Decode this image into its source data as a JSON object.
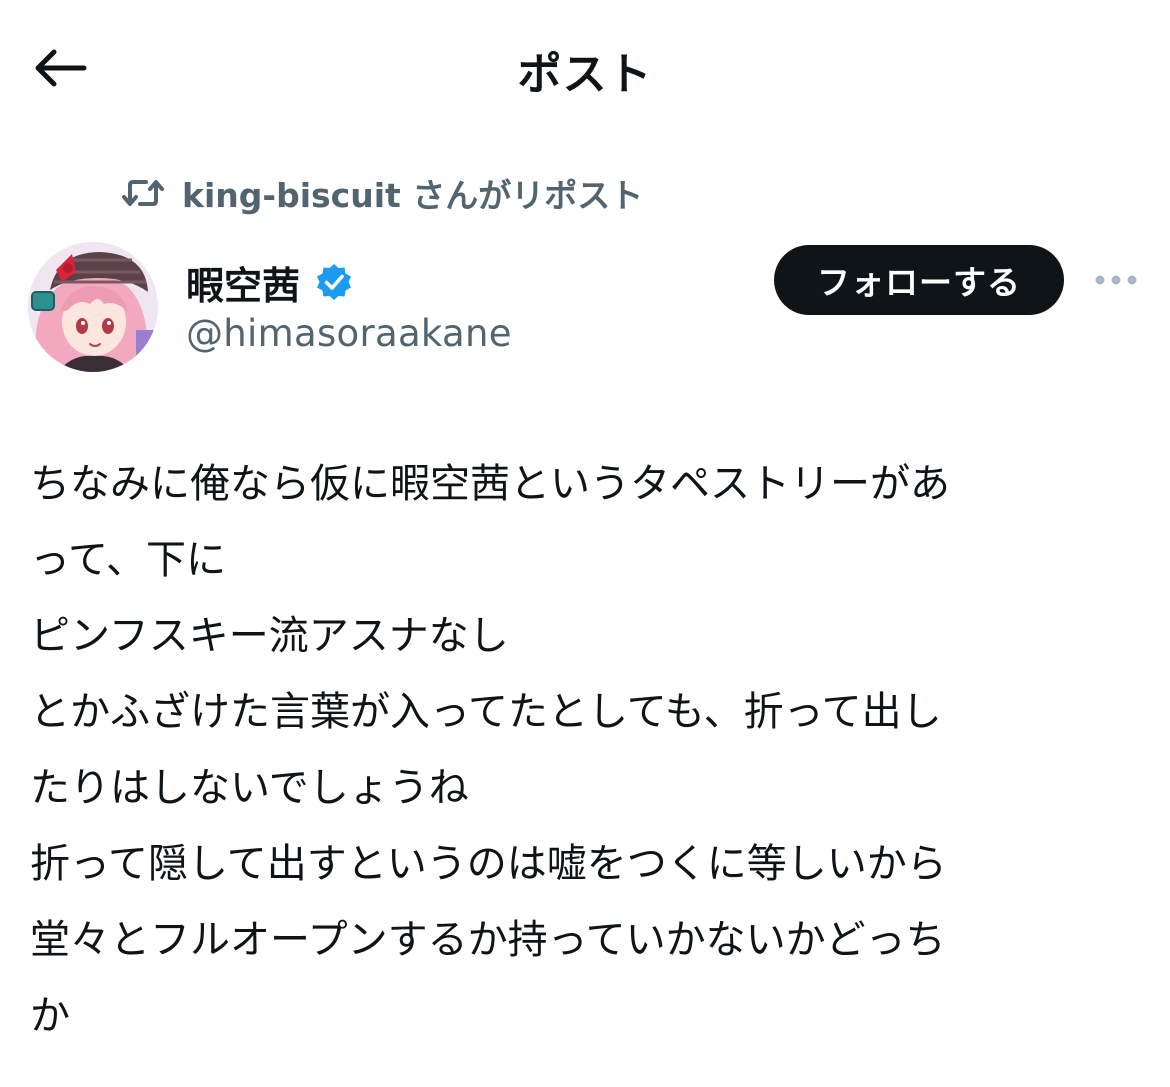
{
  "header": {
    "title": "ポスト",
    "back_icon": "arrow-left-icon"
  },
  "repost": {
    "text": "king-biscuit さんがリポスト",
    "icon": "repost-icon",
    "color": "#536471"
  },
  "author": {
    "name": "暇空茜",
    "handle": "@himasoraakane",
    "verified": true,
    "verified_color": "#1d9bf0"
  },
  "actions": {
    "follow_label": "フォローする",
    "more_icon": "more-horizontal-icon"
  },
  "post": {
    "lines": [
      "ちなみに俺なら仮に暇空茜というタペストリーがあ",
      "って、下に",
      "ピンフスキー流アスナなし",
      "とかふざけた言葉が入ってたとしても、折って出し",
      "たりはしないでしょうね",
      "折って隠して出すというのは嘘をつくに等しいから",
      "堂々とフルオープンするか持っていかないかどっち",
      "か"
    ]
  },
  "colors": {
    "text_primary": "#0f1419",
    "text_secondary": "#536471",
    "follow_bg": "#0f1419",
    "follow_text": "#ffffff",
    "background": "#ffffff"
  }
}
